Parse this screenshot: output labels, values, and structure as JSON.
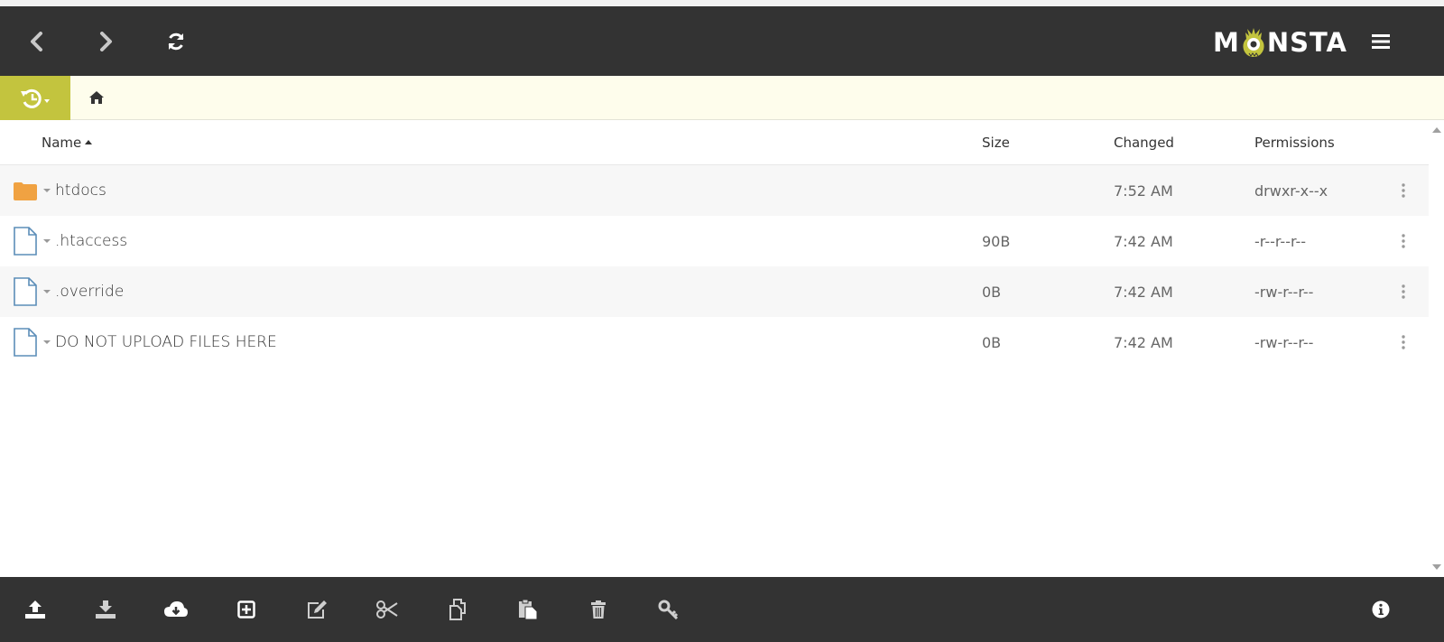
{
  "app": {
    "logo_left": "M",
    "logo_right": "NSTA",
    "colors": {
      "header_bg": "#333333",
      "accent": "#c3c43e",
      "breadcrumb_bg": "#fefdec",
      "folder": "#f0a242",
      "file": "#5b8db8"
    }
  },
  "header": {
    "icons": [
      "chevron-left-icon",
      "chevron-right-icon",
      "refresh-icon",
      "hamburger-menu-icon"
    ]
  },
  "breadcrumb": {
    "icons": [
      "history-icon",
      "home-icon"
    ]
  },
  "table": {
    "columns": {
      "name": "Name",
      "size": "Size",
      "changed": "Changed",
      "permissions": "Permissions"
    },
    "sort_column": "name",
    "sort_direction": "ascending",
    "rows": [
      {
        "type": "folder",
        "name": "htdocs",
        "size": "",
        "changed": "7:52 AM",
        "permissions": "drwxr-x--x"
      },
      {
        "type": "file",
        "name": ".htaccess",
        "size": "90B",
        "changed": "7:42 AM",
        "permissions": "-r--r--r--"
      },
      {
        "type": "file",
        "name": ".override",
        "size": "0B",
        "changed": "7:42 AM",
        "permissions": "-rw-r--r--"
      },
      {
        "type": "file",
        "name": "DO NOT UPLOAD FILES HERE",
        "size": "0B",
        "changed": "7:42 AM",
        "permissions": "-rw-r--r--"
      }
    ]
  },
  "footer": {
    "icons": [
      "upload-icon",
      "download-icon",
      "cloud-download-icon",
      "new-item-icon",
      "edit-icon",
      "cut-icon",
      "copy-icon",
      "paste-icon",
      "delete-icon",
      "key-icon",
      "info-icon"
    ]
  }
}
